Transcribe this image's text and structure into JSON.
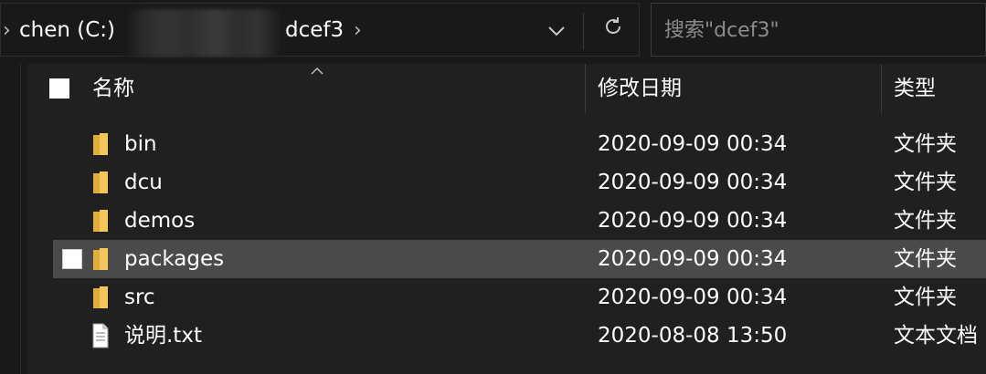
{
  "address_bar": {
    "crumbs": [
      "chen (C:)",
      "dcef3"
    ],
    "dropdown_icon": "chevron-down-icon",
    "refresh_icon": "refresh-icon"
  },
  "search": {
    "placeholder": "搜索\"dcef3\""
  },
  "columns": {
    "name": "名称",
    "date": "修改日期",
    "type": "类型"
  },
  "files": [
    {
      "name": "bin",
      "date": "2020-09-09 00:34",
      "type": "文件夹",
      "icon": "folder-icon"
    },
    {
      "name": "dcu",
      "date": "2020-09-09 00:34",
      "type": "文件夹",
      "icon": "folder-icon"
    },
    {
      "name": "demos",
      "date": "2020-09-09 00:34",
      "type": "文件夹",
      "icon": "folder-icon"
    },
    {
      "name": "packages",
      "date": "2020-09-09 00:34",
      "type": "文件夹",
      "icon": "folder-icon",
      "selected": true
    },
    {
      "name": "src",
      "date": "2020-09-09 00:34",
      "type": "文件夹",
      "icon": "folder-icon"
    },
    {
      "name": "说明.txt",
      "date": "2020-08-08 13:50",
      "type": "文本文档",
      "icon": "text-file-icon"
    }
  ],
  "colors": {
    "background": "#191919",
    "pane": "#202020",
    "selected_row": "#4a4a4a",
    "folder_yellow": "#f3c75a"
  }
}
